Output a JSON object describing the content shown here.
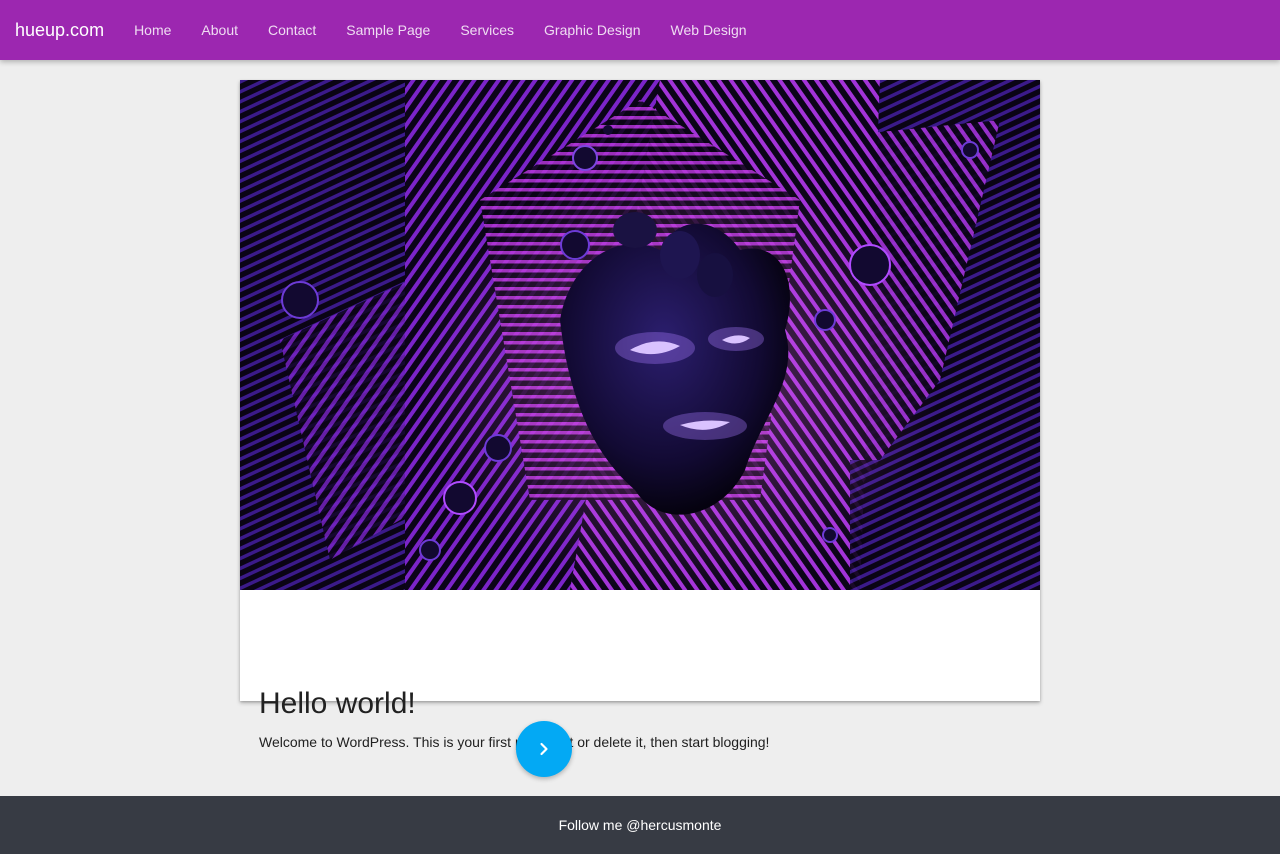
{
  "site": {
    "brand": "hueup.com"
  },
  "nav": {
    "items": [
      {
        "label": "Home"
      },
      {
        "label": "About"
      },
      {
        "label": "Contact"
      },
      {
        "label": "Sample Page"
      },
      {
        "label": "Services"
      },
      {
        "label": "Graphic Design"
      },
      {
        "label": "Web Design"
      }
    ]
  },
  "post": {
    "title": "Hello world!",
    "excerpt": "Welcome to WordPress. This is your first post. Edit or delete it, then start blogging!",
    "image_icon": "abstract-neon-face-image"
  },
  "pagination": {
    "next_icon": "chevron-right-icon"
  },
  "footer": {
    "text": "Follow me @hercusmonte"
  },
  "colors": {
    "navbar": "#9c27b0",
    "fab": "#03a9f4",
    "footer": "#373b44",
    "background": "#eeeeee"
  }
}
